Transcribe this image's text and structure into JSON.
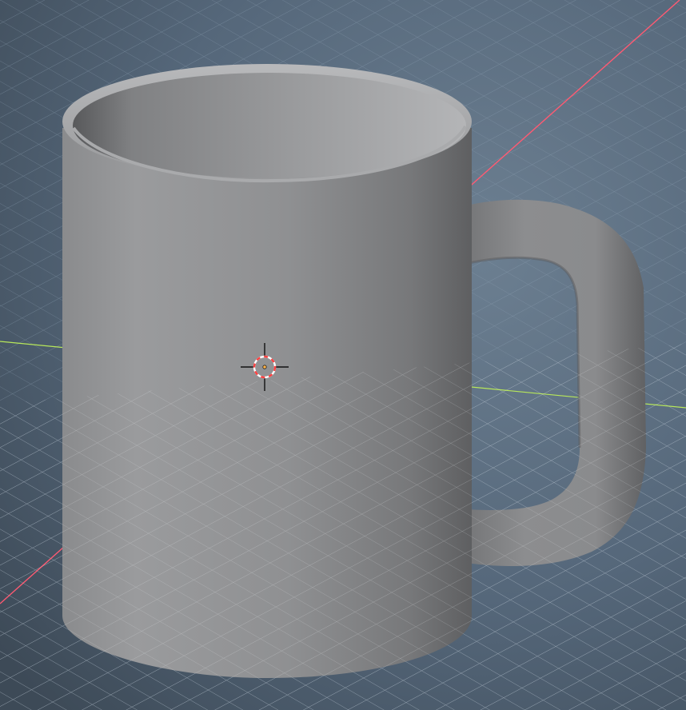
{
  "app": {
    "name": "",
    "view": "3D Viewport"
  },
  "viewport": {
    "background_color": "#46535f",
    "grid_line_color": "#7f93a5",
    "x_axis_color": "#ff5a72",
    "y_axis_color": "#b8e85a",
    "shading": "solid",
    "grid_visible": true
  },
  "object": {
    "type": "mesh",
    "shape": "mug",
    "parts": [
      "body",
      "rim",
      "interior",
      "handle"
    ],
    "color": "#8f9092"
  },
  "cursor": {
    "icon": "3d-cursor-icon",
    "ring_colors": [
      "#ffffff",
      "#ff4040"
    ]
  }
}
